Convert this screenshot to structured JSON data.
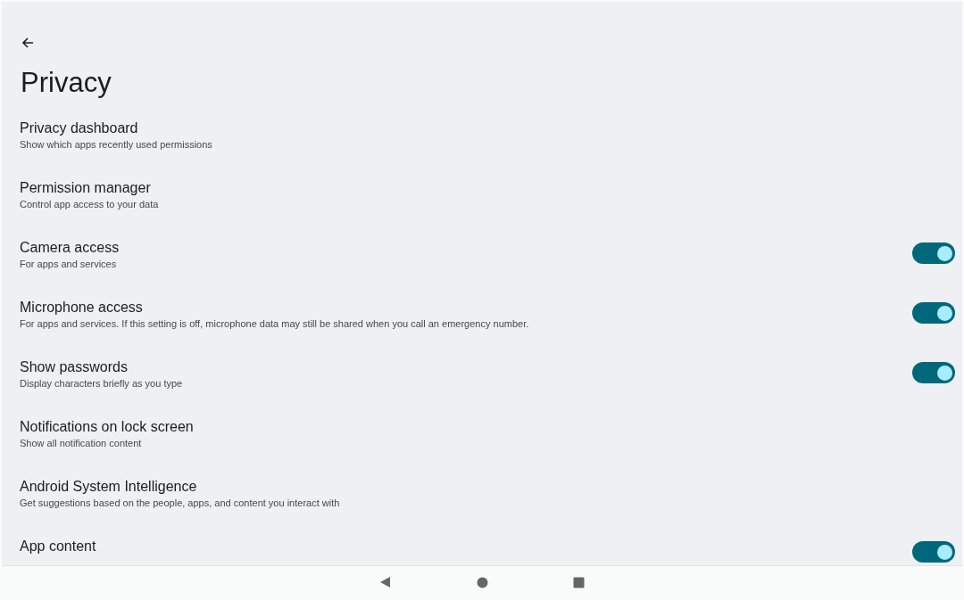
{
  "header": {
    "title": "Privacy"
  },
  "settings": [
    {
      "kind": "link",
      "title": "Privacy dashboard",
      "summary": "Show which apps recently used permissions"
    },
    {
      "kind": "link",
      "title": "Permission manager",
      "summary": "Control app access to your data"
    },
    {
      "kind": "switch",
      "title": "Camera access",
      "summary": "For apps and services",
      "on": true
    },
    {
      "kind": "switch",
      "title": "Microphone access",
      "summary": "For apps and services. If this setting is off, microphone data may still be shared when you call an emergency number.",
      "on": true
    },
    {
      "kind": "switch",
      "title": "Show passwords",
      "summary": "Display characters briefly as you type",
      "on": true
    },
    {
      "kind": "link",
      "title": "Notifications on lock screen",
      "summary": "Show all notification content"
    },
    {
      "kind": "link",
      "title": "Android System Intelligence",
      "summary": "Get suggestions based on the people, apps, and content you interact with"
    },
    {
      "kind": "switch",
      "title": "App content",
      "on": true
    }
  ]
}
